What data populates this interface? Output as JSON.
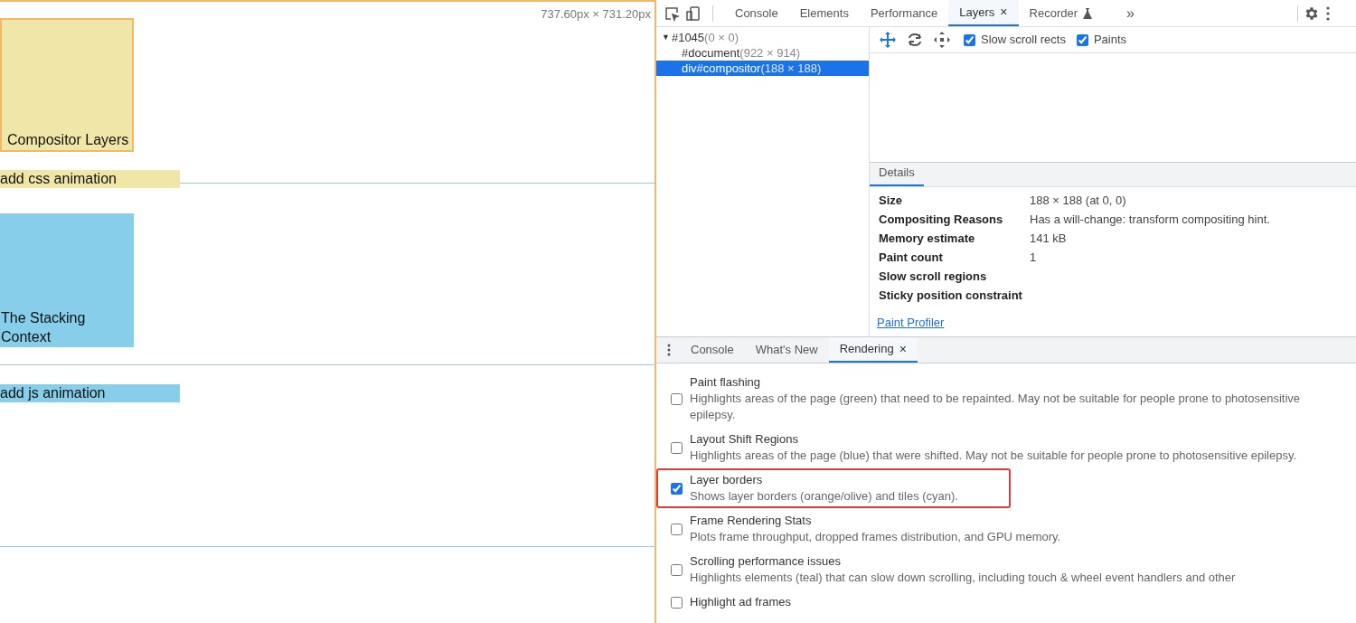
{
  "page": {
    "size_label": "737.60px × 731.20px",
    "elements": [
      {
        "kind": "box",
        "label": "Compositor Layers",
        "color": "#f0e6a8"
      },
      {
        "kind": "bar",
        "label": "add css animation",
        "color": "#f0e6a8"
      },
      {
        "kind": "box",
        "label": "The Stacking Context",
        "color": "#87ceeb"
      },
      {
        "kind": "bar",
        "label": "add js animation",
        "color": "#87ceeb"
      }
    ]
  },
  "devtools": {
    "tabs": [
      {
        "label": "Console",
        "selected": false,
        "closable": false
      },
      {
        "label": "Elements",
        "selected": false,
        "closable": false
      },
      {
        "label": "Performance",
        "selected": false,
        "closable": false
      },
      {
        "label": "Layers",
        "selected": true,
        "closable": true,
        "close": "×"
      },
      {
        "label": "Recorder",
        "selected": false,
        "closable": false
      }
    ],
    "overflow": "»",
    "layer_tree": [
      {
        "arrow": "▼",
        "name": "#1045",
        "dims": "(0 × 0)",
        "selected": false,
        "expanded": true,
        "children": [
          {
            "name": "#document",
            "dims": "(922 × 914)",
            "selected": false
          },
          {
            "name": "div#compositor",
            "dims": "(188 × 188)",
            "selected": true
          }
        ]
      }
    ],
    "toolbar_checks": [
      {
        "label": "Slow scroll rects",
        "checked": true
      },
      {
        "label": "Paints",
        "checked": true
      }
    ],
    "details": {
      "tab": "Details",
      "rows": [
        {
          "key": "Size",
          "value": "188 × 188 (at 0, 0)"
        },
        {
          "key": "Compositing Reasons",
          "value": "Has a will-change: transform compositing hint."
        },
        {
          "key": "Memory estimate",
          "value": "141 kB"
        },
        {
          "key": "Paint count",
          "value": "1"
        },
        {
          "key": "Slow scroll regions",
          "value": ""
        },
        {
          "key": "Sticky position constraint",
          "value": ""
        }
      ],
      "link": "Paint Profiler"
    },
    "drawer": {
      "tabs": [
        {
          "label": "Console",
          "selected": false,
          "closable": false
        },
        {
          "label": "What's New",
          "selected": false,
          "closable": false
        },
        {
          "label": "Rendering",
          "selected": true,
          "closable": true,
          "close": "×"
        }
      ],
      "options": [
        {
          "title": "Paint flashing",
          "description": "Highlights areas of the page (green) that need to be repainted. May not be suitable for people prone to photosensitive epilepsy.",
          "checked": false,
          "highlighted": false
        },
        {
          "title": "Layout Shift Regions",
          "description": "Highlights areas of the page (blue) that were shifted. May not be suitable for people prone to photosensitive epilepsy.",
          "checked": false,
          "highlighted": false
        },
        {
          "title": "Layer borders",
          "description": "Shows layer borders (orange/olive) and tiles (cyan).",
          "checked": true,
          "highlighted": true
        },
        {
          "title": "Frame Rendering Stats",
          "description": "Plots frame throughput, dropped frames distribution, and GPU memory.",
          "checked": false,
          "highlighted": false
        },
        {
          "title": "Scrolling performance issues",
          "description": "Highlights elements (teal) that can slow down scrolling, including touch & wheel event handlers and other",
          "checked": false,
          "highlighted": false
        },
        {
          "title": "Highlight ad frames",
          "checked": false,
          "highlighted": false
        }
      ]
    }
  }
}
